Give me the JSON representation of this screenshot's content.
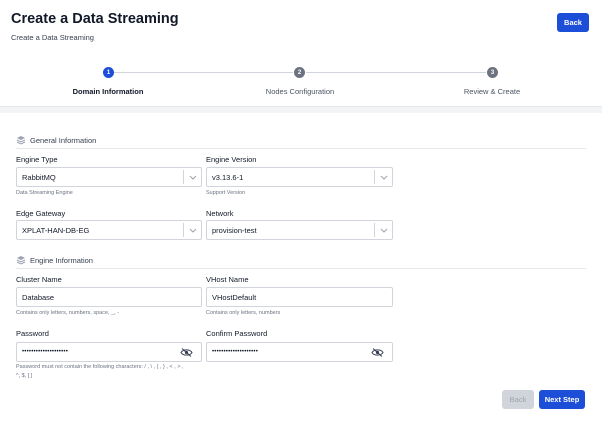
{
  "header": {
    "title": "Create a Data Streaming",
    "subtitle": "Create a Data Streaming",
    "back_label": "Back"
  },
  "steps": [
    {
      "number": "1",
      "label": "Domain Information",
      "active": true
    },
    {
      "number": "2",
      "label": "Nodes Configuration",
      "active": false
    },
    {
      "number": "3",
      "label": "Review & Create",
      "active": false
    }
  ],
  "general": {
    "title": "General Information",
    "engine_type": {
      "label": "Engine Type",
      "value": "RabbitMQ",
      "help": "Data Streaming Engine"
    },
    "engine_version": {
      "label": "Engine Version",
      "value": "v3.13.6-1",
      "help": "Support Version"
    },
    "edge_gateway": {
      "label": "Edge Gateway",
      "value": "XPLAT-HAN-DB-EG"
    },
    "network": {
      "label": "Network",
      "value": "provision-test"
    }
  },
  "engine": {
    "title": "Engine Information",
    "cluster_name": {
      "label": "Cluster Name",
      "value": "Database",
      "help": "Contains only letters, numbers, space, _, -"
    },
    "vhost_name": {
      "label": "VHost Name",
      "value": "VHostDefault",
      "help": "Contains only letters, numbers"
    },
    "password": {
      "label": "Password",
      "value": "••••••••••••••••••••",
      "help_line1": "Password must not contain the following characters: / , \\ , { , } , < , > ,",
      "help_line2": "^, $, [ ]"
    },
    "confirm_password": {
      "label": "Confirm Password",
      "value": "••••••••••••••••••••"
    }
  },
  "footer": {
    "back_label": "Back",
    "next_label": "Next Step"
  },
  "colors": {
    "primary": "#1d4ed8",
    "step_active": "#1d4ed8",
    "step_inactive": "#6b7280",
    "disabled": "#d1d5db"
  }
}
